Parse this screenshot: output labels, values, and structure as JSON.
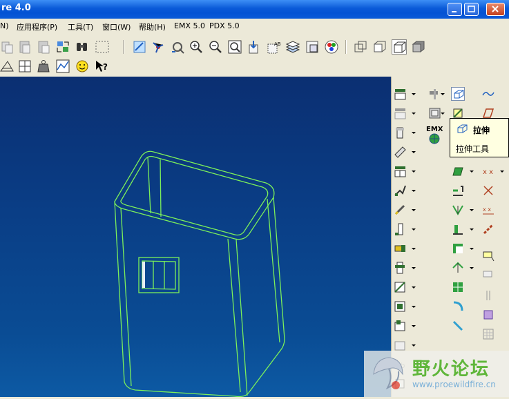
{
  "window": {
    "title": "re 4.0"
  },
  "menu": [
    "N)",
    "应用程序(P)",
    "工具(T)",
    "窗口(W)",
    "帮助(H)",
    "EMX 5.0",
    "PDX 5.0"
  ],
  "toolbar": {
    "icons": [
      "copy-icon",
      "paste-icon",
      "paste-special-icon",
      "regenerate-icon",
      "find-icon",
      "select-box-icon",
      "repaint-icon",
      "spin-center-icon",
      "orient-icon",
      "zoom-in-icon",
      "zoom-out-icon",
      "refit-icon",
      "reorient-icon",
      "named-view-icon",
      "layers-icon",
      "view-manager-icon",
      "appearance-icon",
      "wireframe-icon",
      "hidden-line-icon",
      "no-hidden-icon",
      "shading-icon"
    ],
    "row2_icons": [
      "measure-icon",
      "analysis-icon",
      "weight-icon",
      "graph-icon",
      "smiley-icon",
      "whats-this-icon"
    ]
  },
  "panel": {
    "emx_label": "EMX"
  },
  "tooltip": {
    "title": "拉伸",
    "body": "拉伸工具"
  },
  "watermark": {
    "name": "野火论坛",
    "url": "www.proewildfire.cn"
  },
  "colors": {
    "accent": "#0a5ad8",
    "model": "#7cf05a",
    "viewport": "#0a3d85"
  }
}
